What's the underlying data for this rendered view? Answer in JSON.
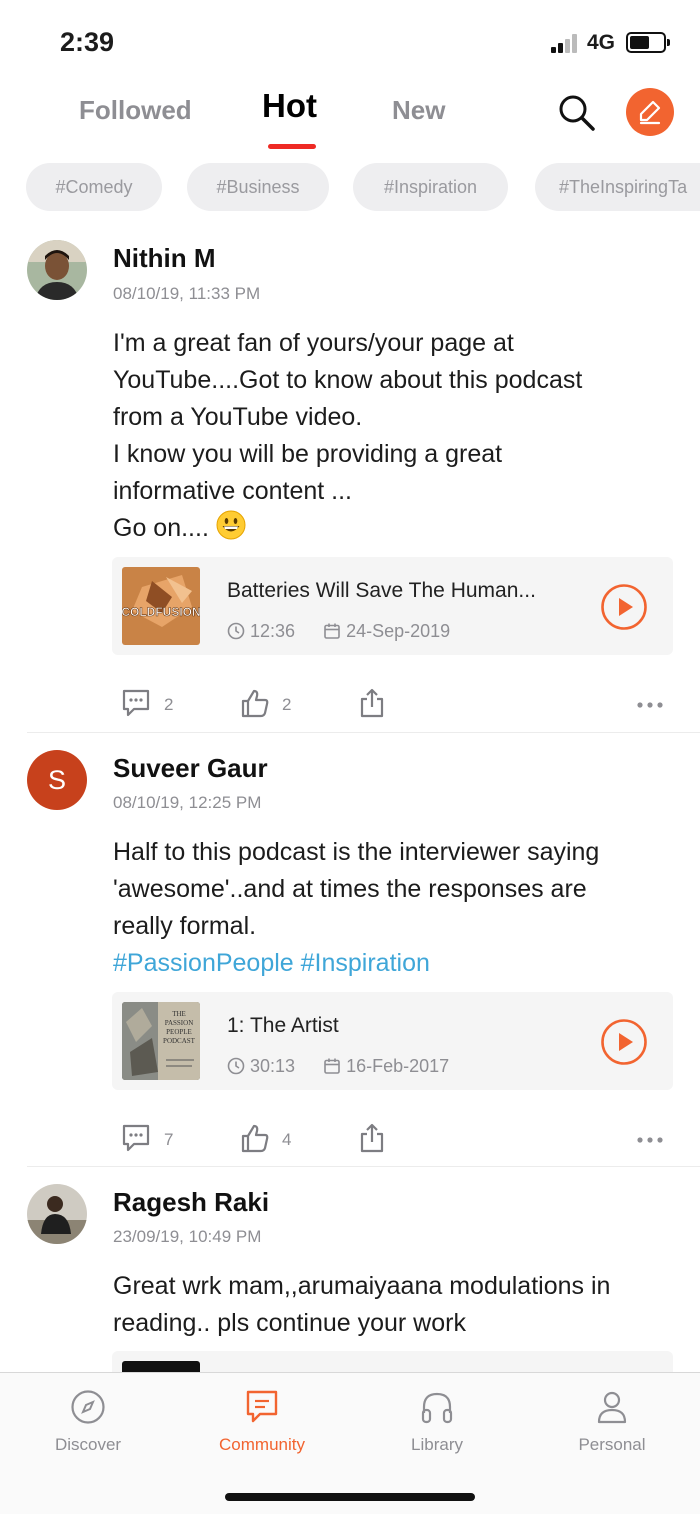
{
  "status_bar": {
    "time": "2:39",
    "network": "4G"
  },
  "top_tabs": [
    {
      "label": "Followed"
    },
    {
      "label": "Hot",
      "active": true
    },
    {
      "label": "New"
    }
  ],
  "icons": {
    "search": "search-icon",
    "compose": "pencil-icon",
    "comment": "comment-icon",
    "like": "thumbs-up-icon",
    "share": "share-icon",
    "more": "more-icon",
    "play": "play-icon",
    "clock": "clock-icon",
    "calendar": "calendar-icon"
  },
  "colors": {
    "accent": "#f26430",
    "active_underline": "#ee2a24",
    "hashtag": "#3fa6d8",
    "muted": "#8e8e93"
  },
  "chips": [
    "#Comedy",
    "#Business",
    "#Inspiration",
    "#TheInspiringTa"
  ],
  "posts": [
    {
      "author": "Nithin M",
      "timestamp": "08/10/19, 11:33 PM",
      "lines": [
        "I'm a great fan of yours/your page at",
        "YouTube....Got to know about this podcast",
        "from a YouTube video.",
        "I know you will be providing a great",
        "informative content ...",
        "Go on...."
      ],
      "emoji": "grinning-face",
      "episode": {
        "title": "Batteries Will Save The Human...",
        "duration": "12:36",
        "date": "24-Sep-2019",
        "thumb_text": "COLDFUSION"
      },
      "comments": "2",
      "likes": "2"
    },
    {
      "author": "Suveer Gaur",
      "avatar_letter": "S",
      "timestamp": "08/10/19, 12:25 PM",
      "lines": [
        "Half to this podcast is the interviewer saying",
        "'awesome'..and at times the responses are",
        "really formal."
      ],
      "hashtags": "#PassionPeople #Inspiration",
      "episode": {
        "title": "1: The Artist",
        "duration": "30:13",
        "date": "16-Feb-2017",
        "thumb_text": "THE PASSION PEOPLE PODCAST"
      },
      "comments": "7",
      "likes": "4"
    },
    {
      "author": "Ragesh Raki",
      "timestamp": "23/09/19, 10:49 PM",
      "lines": [
        "Great wrk mam,,arumaiyaana modulations in",
        "reading.. pls continue your work"
      ]
    }
  ],
  "tabbar": [
    {
      "label": "Discover",
      "icon": "compass-icon"
    },
    {
      "label": "Community",
      "icon": "chat-icon",
      "active": true
    },
    {
      "label": "Library",
      "icon": "headphones-icon"
    },
    {
      "label": "Personal",
      "icon": "person-icon"
    }
  ]
}
